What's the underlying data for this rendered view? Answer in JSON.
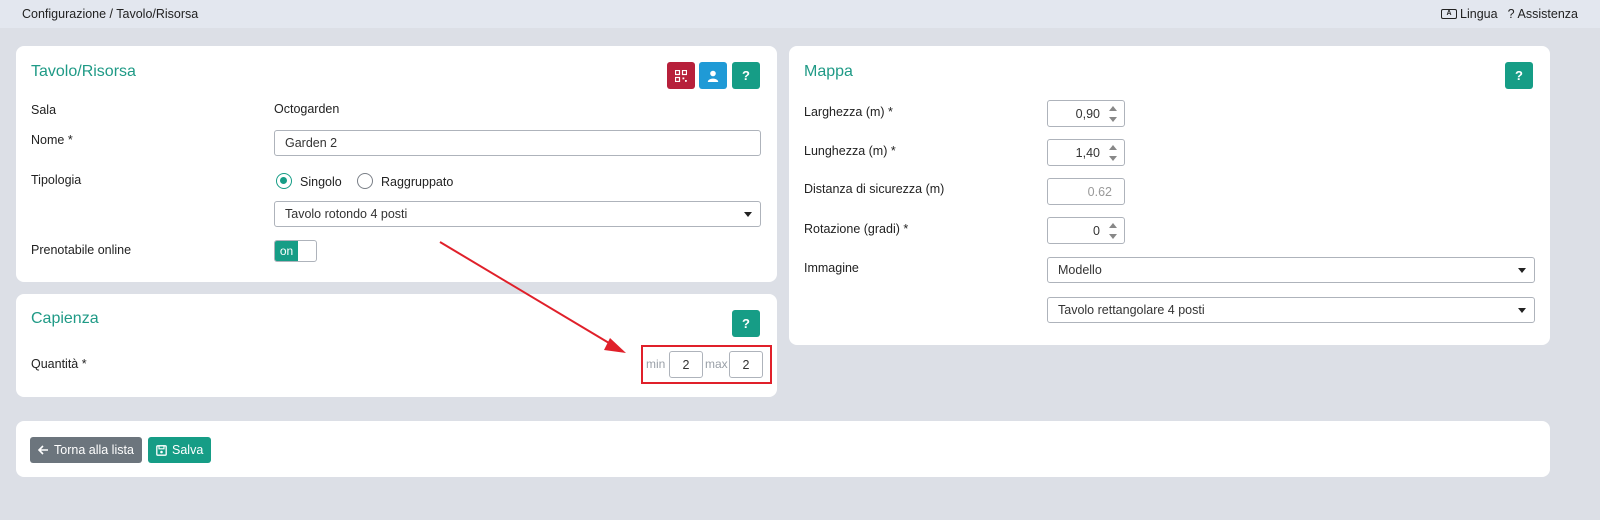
{
  "breadcrumb": "Configurazione / Tavolo/Risorsa",
  "topbar": {
    "language_label": "Lingua",
    "help_label": "Assistenza",
    "help_glyph": "?"
  },
  "tavolo": {
    "title": "Tavolo/Risorsa",
    "help_glyph": "?",
    "sala_label": "Sala",
    "sala_value": "Octogarden",
    "nome_label": "Nome *",
    "nome_value": "Garden 2",
    "tipologia_label": "Tipologia",
    "radio_singolo": "Singolo",
    "radio_raggruppato": "Raggruppato",
    "tipologia_selected": "Singolo",
    "modello_value": "Tavolo rotondo 4 posti",
    "prenotabile_label": "Prenotabile online",
    "toggle_label": "on"
  },
  "capienza": {
    "title": "Capienza",
    "help_glyph": "?",
    "quantita_label": "Quantità *",
    "min_label": "min",
    "min_value": "2",
    "max_label": "max",
    "max_value": "2"
  },
  "mappa": {
    "title": "Mappa",
    "help_glyph": "?",
    "larghezza_label": "Larghezza (m) *",
    "larghezza_value": "0,90",
    "lunghezza_label": "Lunghezza (m) *",
    "lunghezza_value": "1,40",
    "distanza_label": "Distanza di sicurezza (m)",
    "distanza_value": "0.62",
    "rotazione_label": "Rotazione (gradi) *",
    "rotazione_value": "0",
    "immagine_label": "Immagine",
    "immagine_value": "Modello",
    "immagine_modello_value": "Tavolo rettangolare 4 posti"
  },
  "actions": {
    "back_label": "Torna alla lista",
    "save_label": "Salva"
  },
  "colors": {
    "accent": "#169d86",
    "danger": "#b7203b",
    "info": "#1f9ad6",
    "secondary": "#6c757d",
    "highlight": "#e0202a"
  }
}
